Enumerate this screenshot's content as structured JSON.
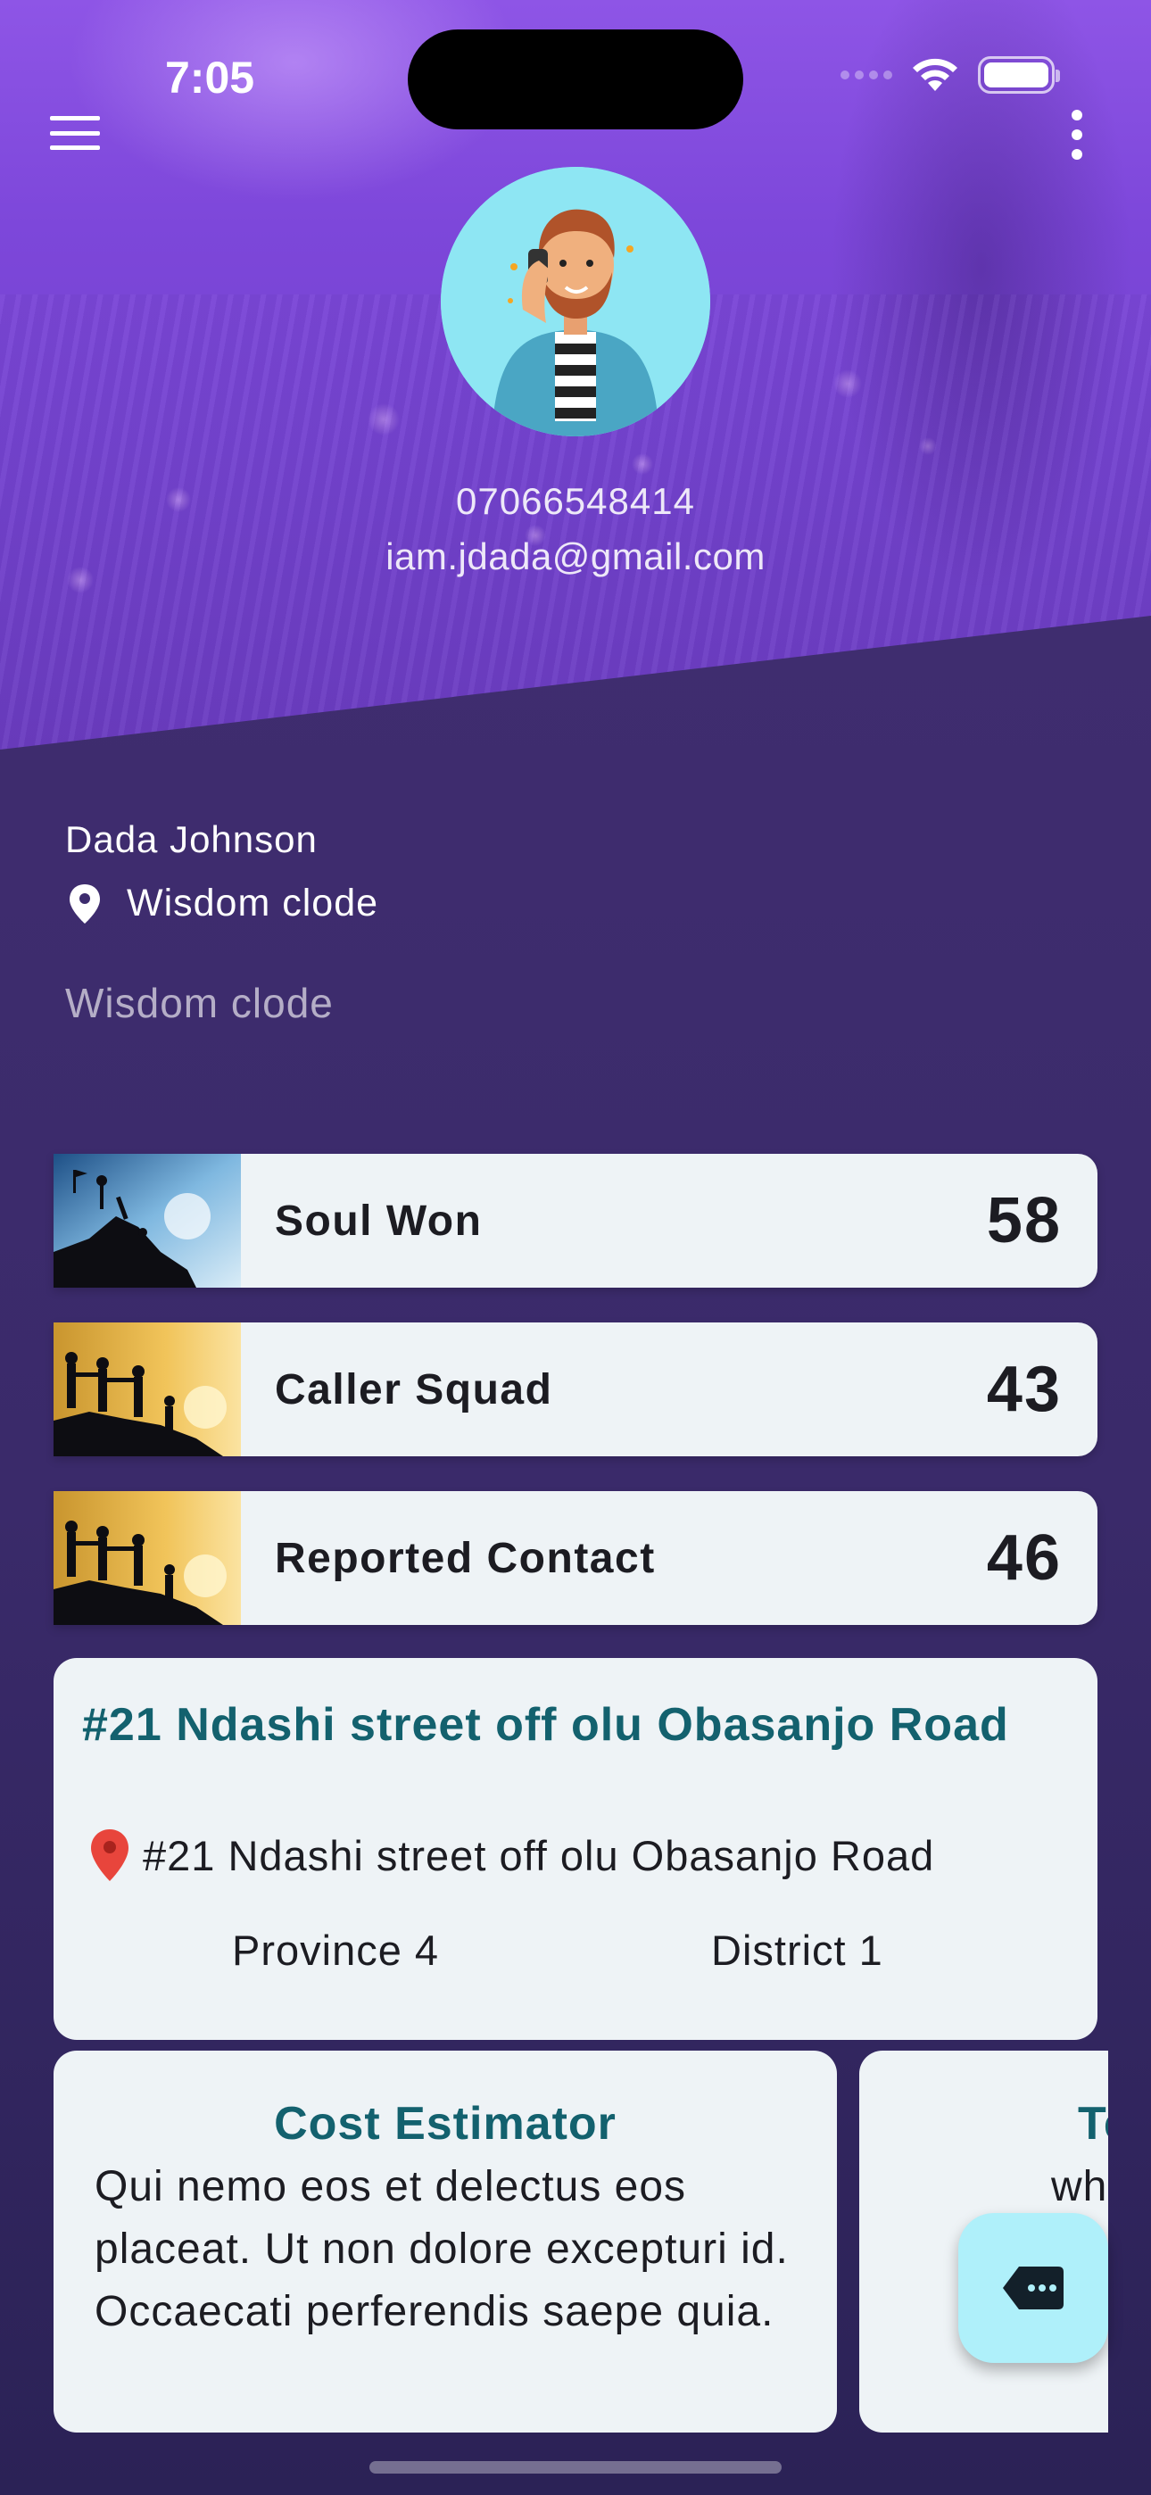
{
  "status_bar": {
    "time": "7:05"
  },
  "profile": {
    "phone": "07066548414",
    "email": "iam.jdada@gmail.com",
    "name": "Dada Johnson",
    "location": "Wisdom clode",
    "bio": "Wisdom clode"
  },
  "stats": [
    {
      "label": "Soul Won",
      "value": "58"
    },
    {
      "label": "Caller Squad",
      "value": "43"
    },
    {
      "label": "Reported Contact",
      "value": "46"
    }
  ],
  "address_card": {
    "title": "#21 Ndashi street off olu Obasanjo Road",
    "address": "#21 Ndashi street off olu Obasanjo Road",
    "province": "Province 4",
    "district": "District 1"
  },
  "cards": [
    {
      "title": "Cost Estimator",
      "description": "Qui nemo eos et delectus eos placeat. Ut non dolore excepturi id. Occaecati perferendis saepe quia."
    },
    {
      "title": "Te",
      "description": "wh"
    }
  ],
  "colors": {
    "hero_purple": "#7d47da",
    "background": "#3a2a6a",
    "card_bg": "#eef3f6",
    "accent_teal": "#13616e",
    "fab_bg": "#aff0fa"
  }
}
